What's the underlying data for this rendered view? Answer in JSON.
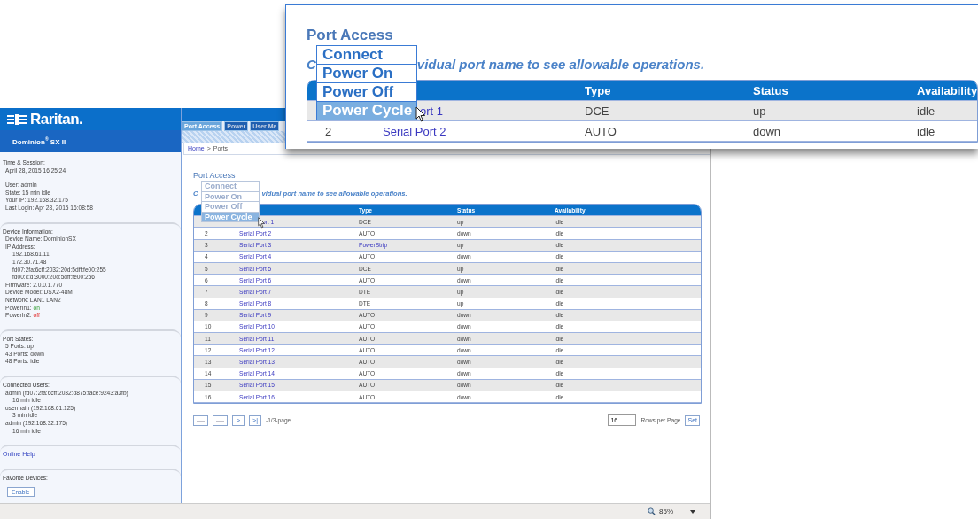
{
  "callout": {
    "title": "Port Access",
    "instruction_start": "C",
    "instruction_rest": "vidual port name to see allowable operations.",
    "menu": [
      {
        "label": "Connect",
        "selected": false
      },
      {
        "label": "Power On",
        "selected": false
      },
      {
        "label": "Power Off",
        "selected": false
      },
      {
        "label": "Power Cycle",
        "selected": true
      }
    ],
    "columns": [
      "Type",
      "Status",
      "Availability"
    ],
    "rows": [
      {
        "name": "ort 1",
        "type": "DCE",
        "type_link": false,
        "status": "up",
        "availability": "idle"
      },
      {
        "number": "2",
        "name": "Serial Port 2",
        "type": "AUTO",
        "type_link": false,
        "status": "down",
        "availability": "idle"
      }
    ]
  },
  "sidebar": {
    "logo": "Raritan.",
    "product": "Dominion$^{®}$ SX II",
    "sections": [
      {
        "kind": "info",
        "title": "Time & Session:",
        "groups": [
          [
            {
              "text": "April 28, 2015 16:25:24"
            }
          ],
          [
            {
              "text": "User: admin"
            },
            {
              "text": "State: 15 min idle"
            },
            {
              "text": "Your IP: 192.168.32.175"
            },
            {
              "text": "Last Login: Apr 28, 2015 16:08:58"
            }
          ]
        ]
      },
      {
        "kind": "info",
        "title": "Device Information:",
        "groups": [
          [
            {
              "text": "Device Name: DominionSX"
            },
            {
              "text": "IP Address:",
              "children": [
                {
                  "text": "192.168.61.11"
                },
                {
                  "text": "172.30.71.48"
                },
                {
                  "text": "fd07:2fa:6cff:2032:20d:5dff:fe00:255"
                },
                {
                  "text": "fd00:c:d:3000:20d:5dff:fe00:256"
                }
              ]
            },
            {
              "text": "Firmware: 2.0.0.1.770"
            },
            {
              "text": "Device Model: DSX2-48M"
            },
            {
              "text": "Network: LAN1 LAN2"
            },
            {
              "text": "PowerIn1:",
              "value": "on",
              "on": true
            },
            {
              "text": "PowerIn2:",
              "value": "off",
              "on": false
            }
          ]
        ]
      },
      {
        "kind": "info",
        "title": "Port States:",
        "groups": [
          [
            {
              "text": "5 Ports: up"
            },
            {
              "text": "43 Ports: down"
            },
            {
              "text": "48 Ports: idle"
            }
          ]
        ]
      },
      {
        "kind": "info",
        "title": "Connected Users:",
        "groups": [
          [
            {
              "text": "admin (fd07:2fa:6cff:2032:d875:face:9243:a3fb)",
              "children": [
                {
                  "text": "16 min idle"
                }
              ]
            },
            {
              "text": "usermain (192.168.61.125)",
              "children": [
                {
                  "text": "3 min idle"
                }
              ]
            },
            {
              "text": "admin (192.168.32.175)",
              "children": [
                {
                  "text": "16 min idle"
                }
              ]
            }
          ]
        ]
      },
      {
        "kind": "link",
        "title": "Online Help"
      },
      {
        "kind": "button",
        "title": "Favorite Devices:",
        "button": "Enable"
      }
    ]
  },
  "tabs": [
    {
      "label": "Port Access",
      "selected": true
    },
    {
      "label": "Power",
      "selected": false
    },
    {
      "label": "User Ma",
      "selected": false
    }
  ],
  "breadcrumb": [
    {
      "label": "Home",
      "kind": "link"
    },
    {
      "label": ">",
      "kind": "separator"
    },
    {
      "label": "Ports",
      "kind": "text"
    }
  ],
  "main": {
    "title": "Port Access",
    "instruction_start": "C",
    "instruction_rest": "vidual port name to see allowable operations.",
    "menu": [
      {
        "label": "Connect",
        "selected": false
      },
      {
        "label": "Power On",
        "selected": false
      },
      {
        "label": "Power Off",
        "selected": false
      },
      {
        "label": "Power Cycle",
        "selected": true
      }
    ],
    "table": {
      "columns": [
        "Type",
        "Status",
        "Availability"
      ],
      "rows": [
        {
          "name": "ort 1",
          "type": "DCE",
          "type_link": false,
          "status": "up",
          "availability": "idle"
        },
        {
          "number": "2",
          "name": "Serial Port 2",
          "type": "AUTO",
          "type_link": false,
          "status": "down",
          "availability": "idle"
        },
        {
          "number": "3",
          "name": "Serial Port 3",
          "type": "PowerStrip",
          "type_link": true,
          "status": "up",
          "availability": "idle"
        },
        {
          "number": "4",
          "name": "Serial Port 4",
          "type": "AUTO",
          "type_link": false,
          "status": "down",
          "availability": "idle"
        },
        {
          "number": "5",
          "name": "Serial Port 5",
          "type": "DCE",
          "type_link": false,
          "status": "up",
          "availability": "idle"
        },
        {
          "number": "6",
          "name": "Serial Port 6",
          "type": "AUTO",
          "type_link": false,
          "status": "down",
          "availability": "idle"
        },
        {
          "number": "7",
          "name": "Serial Port 7",
          "type": "DTE",
          "type_link": false,
          "status": "up",
          "availability": "idle"
        },
        {
          "number": "8",
          "name": "Serial Port 8",
          "type": "DTE",
          "type_link": false,
          "status": "up",
          "availability": "idle"
        },
        {
          "number": "9",
          "name": "Serial Port 9",
          "type": "AUTO",
          "type_link": false,
          "status": "down",
          "availability": "idle"
        },
        {
          "number": "10",
          "name": "Serial Port 10",
          "type": "AUTO",
          "type_link": false,
          "status": "down",
          "availability": "idle"
        },
        {
          "number": "11",
          "name": "Serial Port 11",
          "type": "AUTO",
          "type_link": false,
          "status": "down",
          "availability": "idle"
        },
        {
          "number": "12",
          "name": "Serial Port 12",
          "type": "AUTO",
          "type_link": false,
          "status": "down",
          "availability": "idle"
        },
        {
          "number": "13",
          "name": "Serial Port 13",
          "type": "AUTO",
          "type_link": false,
          "status": "down",
          "availability": "idle"
        },
        {
          "number": "14",
          "name": "Serial Port 14",
          "type": "AUTO",
          "type_link": false,
          "status": "down",
          "availability": "idle"
        },
        {
          "number": "15",
          "name": "Serial Port 15",
          "type": "AUTO",
          "type_link": false,
          "status": "down",
          "availability": "idle"
        },
        {
          "number": "16",
          "name": "Serial Port 16",
          "type": "AUTO",
          "type_link": false,
          "status": "down",
          "availability": "idle"
        }
      ]
    },
    "pagination": {
      "buttons": [
        {
          "disabled": true
        },
        {
          "disabled": true
        },
        {
          "label": ">",
          "disabled": false
        },
        {
          "label": ">|",
          "disabled": false
        }
      ],
      "page_info": "-1/3-page",
      "rows_per_page": "16",
      "rows_label": "Rows per Page",
      "set_button": "Set"
    }
  },
  "status_bar": {
    "zoom": "85%"
  }
}
